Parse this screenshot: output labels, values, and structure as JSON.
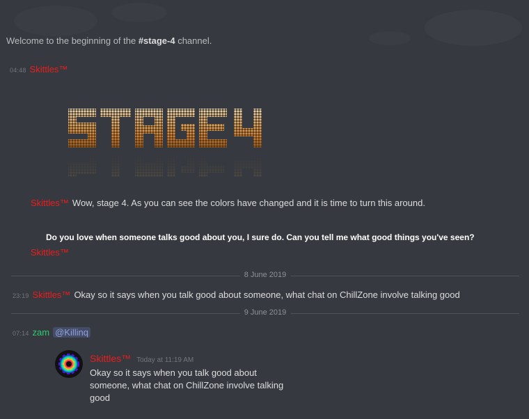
{
  "channel": {
    "welcome_prefix": "Welcome to the beginning of the ",
    "channel_name": "#stage-4",
    "welcome_suffix": " channel."
  },
  "messages": [
    {
      "time": "04:48",
      "user": "Skittles™",
      "user_color": "#e91e1e",
      "image_alt": "STAGE 4"
    },
    {
      "user": "Skittles™",
      "text": "Wow, stage 4. As you can see the colors have changed and it is time to turn this around."
    },
    {
      "bold_text": "Do you love when someone talks good about you, I sure do. Can you tell me what good things you've seen?",
      "user": "Skittles™"
    },
    {
      "time": "23:19",
      "user": "Skittles™",
      "text": "Okay so it says when you talk good about someone, what chat on ChillZone involve talking good"
    },
    {
      "time": "07:14",
      "user": "zam",
      "user_color": "#2ecc71",
      "mention": "@Killinq"
    }
  ],
  "dividers": [
    "8 June 2019",
    "9 June 2019"
  ],
  "quote": {
    "user": "Skittles™",
    "when": "Today at 11:19 AM",
    "text": "Okay so it says when you talk good about someone, what chat on ChillZone involve talking good"
  }
}
